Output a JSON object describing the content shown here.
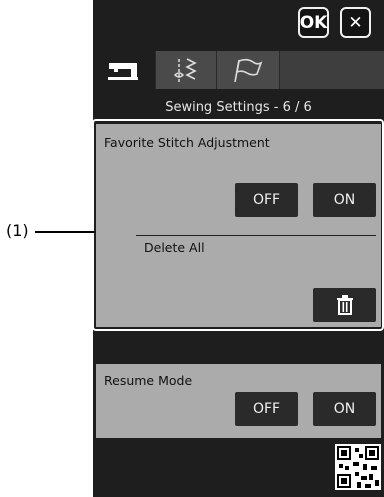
{
  "header": {
    "ok_label": "OK",
    "close_symbol": "✕"
  },
  "tabs": [
    {
      "icon": "sewing-machine-icon",
      "selected": true
    },
    {
      "icon": "stitch-icon",
      "selected": false
    },
    {
      "icon": "flag-icon",
      "selected": false
    }
  ],
  "page_title": "Sewing Settings  -  6 / 6",
  "settings": {
    "favorite_stitch": {
      "label": "Favorite Stitch Adjustment",
      "off_label": "OFF",
      "on_label": "ON",
      "delete_all_label": "Delete All"
    },
    "resume_mode": {
      "label": "Resume Mode",
      "off_label": "OFF",
      "on_label": "ON"
    }
  },
  "callout": {
    "label": "(1)"
  },
  "colors": {
    "screen_bg": "#1e1e1e",
    "panel_bg": "#ababab",
    "button_bg": "#2a2a2a",
    "highlight": "#ffffff"
  }
}
